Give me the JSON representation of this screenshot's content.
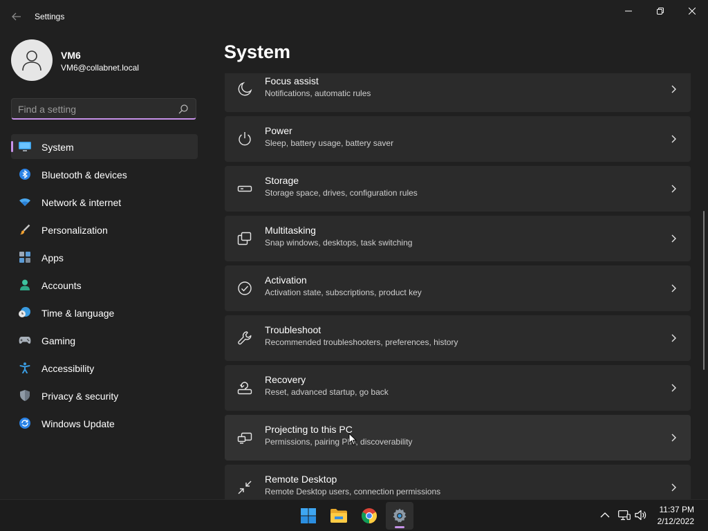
{
  "window": {
    "title": "Settings"
  },
  "user": {
    "name": "VM6",
    "email": "VM6@collabnet.local"
  },
  "search": {
    "placeholder": "Find a setting"
  },
  "sidebar": {
    "items": [
      {
        "label": "System",
        "icon": "system-icon",
        "active": true
      },
      {
        "label": "Bluetooth & devices",
        "icon": "bluetooth-icon"
      },
      {
        "label": "Network & internet",
        "icon": "wifi-icon"
      },
      {
        "label": "Personalization",
        "icon": "brush-icon"
      },
      {
        "label": "Apps",
        "icon": "apps-icon"
      },
      {
        "label": "Accounts",
        "icon": "account-icon"
      },
      {
        "label": "Time & language",
        "icon": "clock-globe-icon"
      },
      {
        "label": "Gaming",
        "icon": "gamepad-icon"
      },
      {
        "label": "Accessibility",
        "icon": "accessibility-icon"
      },
      {
        "label": "Privacy & security",
        "icon": "shield-icon"
      },
      {
        "label": "Windows Update",
        "icon": "update-icon"
      }
    ]
  },
  "main": {
    "title": "System",
    "items": [
      {
        "title": "Focus assist",
        "desc": "Notifications, automatic rules",
        "icon": "moon-icon"
      },
      {
        "title": "Power",
        "desc": "Sleep, battery usage, battery saver",
        "icon": "power-icon"
      },
      {
        "title": "Storage",
        "desc": "Storage space, drives, configuration rules",
        "icon": "drive-icon"
      },
      {
        "title": "Multitasking",
        "desc": "Snap windows, desktops, task switching",
        "icon": "multitasking-icon"
      },
      {
        "title": "Activation",
        "desc": "Activation state, subscriptions, product key",
        "icon": "check-circle-icon"
      },
      {
        "title": "Troubleshoot",
        "desc": "Recommended troubleshooters, preferences, history",
        "icon": "wrench-icon"
      },
      {
        "title": "Recovery",
        "desc": "Reset, advanced startup, go back",
        "icon": "recovery-icon"
      },
      {
        "title": "Projecting to this PC",
        "desc": "Permissions, pairing PIN, discoverability",
        "icon": "projector-icon",
        "hover": true
      },
      {
        "title": "Remote Desktop",
        "desc": "Remote Desktop users, connection permissions",
        "icon": "remote-desktop-icon"
      }
    ]
  },
  "taskbar": {
    "apps": [
      "windows-start-icon",
      "file-explorer-icon",
      "chrome-icon",
      "settings-gear-icon"
    ],
    "time": "11:37 PM",
    "date": "2/12/2022"
  },
  "colors": {
    "accent": "#c792ea",
    "background": "#202020",
    "card": "#2b2b2b"
  }
}
